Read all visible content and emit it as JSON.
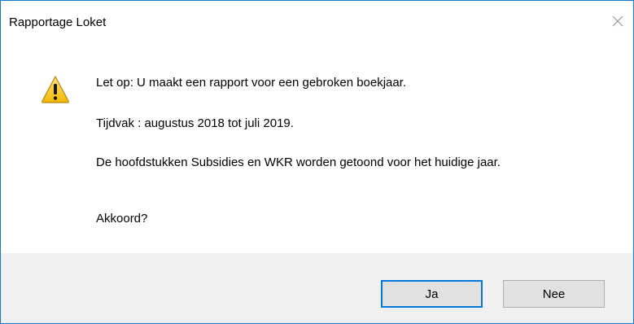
{
  "window": {
    "title": "Rapportage Loket"
  },
  "message": {
    "line1": "Let op: U maakt een rapport voor een gebroken boekjaar.",
    "line2": "Tijdvak : augustus 2018 tot juli 2019.",
    "line3": "De hoofdstukken Subsidies en WKR worden getoond voor het huidige jaar.",
    "line4": "Akkoord?"
  },
  "buttons": {
    "yes_label": "Ja",
    "no_label": "Nee"
  },
  "icons": {
    "warning": "warning-icon",
    "close": "close-icon"
  },
  "colors": {
    "border": "#1979ca",
    "footer": "#f0f0f0",
    "focus": "#0078d7",
    "warning_fill": "#f7c72b"
  }
}
